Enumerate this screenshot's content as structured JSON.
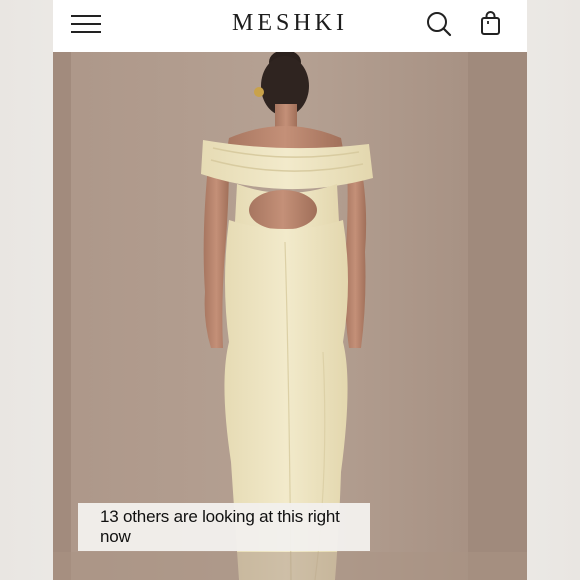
{
  "header": {
    "brand": "MESHKI",
    "menu_icon": "hamburger-menu-icon",
    "search_icon": "search-icon",
    "cart_icon": "shopping-bag-icon"
  },
  "product_image": {
    "subject": "cream off-the-shoulder maxi dress, back view"
  },
  "notice": {
    "text": "13 others are looking at this right now"
  },
  "colors": {
    "background": "#a79386",
    "dress": "#efe7c3",
    "header_bg": "#ffffff",
    "notice_bg": "#f2f0ec"
  }
}
